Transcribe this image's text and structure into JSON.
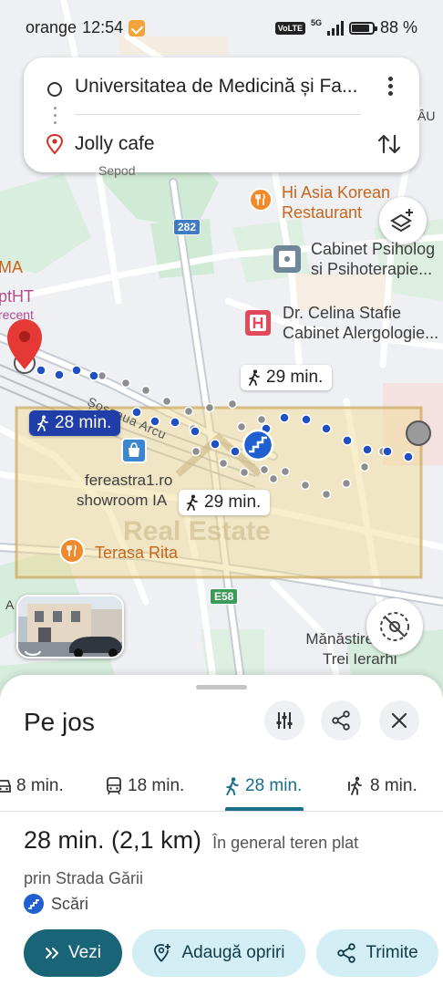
{
  "status_bar": {
    "carrier": "orange",
    "time": "12:54",
    "volte": "VoLTE",
    "network": "5G",
    "battery": "88 %",
    "battery_level": 0.88
  },
  "route_card": {
    "origin": "Universitatea de Medicină și Fa...",
    "destination": "Jolly cafe"
  },
  "map": {
    "labels": {
      "hi_asia_1": "Hi Asia Korean",
      "hi_asia_2": "Restaurant",
      "cabinet_psi_1": "Cabinet Psiholog",
      "cabinet_psi_2": "si Psihoterapie...",
      "dr_celina_1": "Dr. Celina Stafie",
      "dr_celina_2": "Cabinet Alergologie...",
      "fereastra_1": "fereastra1.ro",
      "fereastra_2": "showroom IA",
      "terasa": "Terasa Rita",
      "manastirea_1": "Mănăstirea S",
      "manastirea_2": "Trei Ierarhi",
      "left_ma": "MA",
      "left_ptht": "ptHT",
      "left_recent": "recent",
      "left_a": "A",
      "edge_u": "ÂU",
      "street": "Șoseaua Arcu",
      "sepod": "Sepod",
      "watermark": "Real Estate"
    },
    "shields": {
      "r282": "282",
      "e58": "E58"
    },
    "time_chips": {
      "selected": "28 min.",
      "alt_top": "29 min.",
      "alt_bottom": "29 min."
    }
  },
  "sheet": {
    "title": "Pe jos",
    "modes": [
      {
        "label": "8 min.",
        "icon": "car-icon"
      },
      {
        "label": "18 min.",
        "icon": "transit-icon"
      },
      {
        "label": "28 min.",
        "icon": "walk-icon",
        "active": true
      },
      {
        "label": "8 min.",
        "icon": "ride-hail-icon"
      }
    ],
    "duration": "28 min. (2,1 km)",
    "terrain": "În general teren plat",
    "via": "prin Strada Gării",
    "stairs": "Scări",
    "buttons": {
      "start": "Vezi",
      "add_stops": "Adaugă opriri",
      "share": "Trimite"
    }
  },
  "colors": {
    "route_selected": "#1f3ea8",
    "route_alt": "#8d8d8d",
    "primary_button": "#1a6478",
    "secondary_button": "#d4eef5",
    "active_mode": "#1a6f8a"
  }
}
